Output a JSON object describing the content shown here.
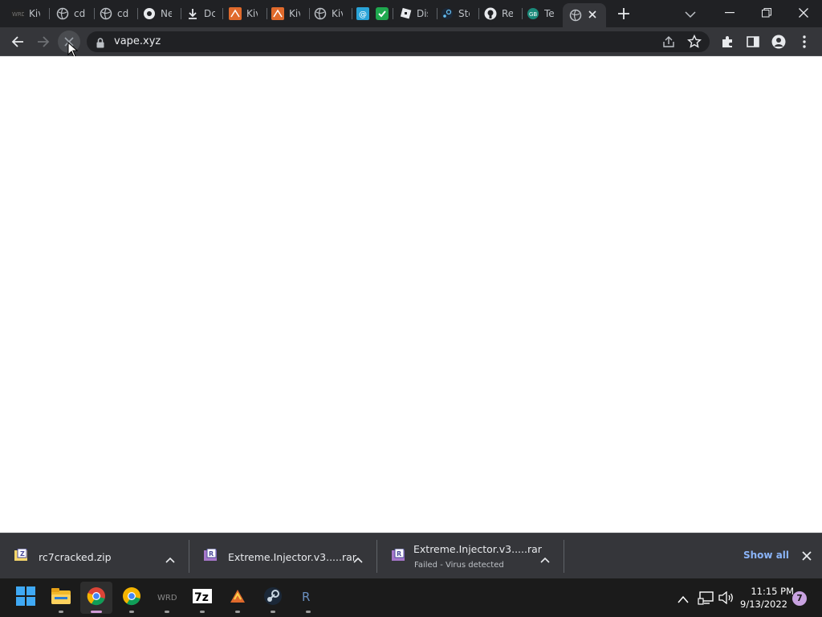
{
  "colors": {
    "tabstrip_bg": "#202124",
    "toolbar_bg": "#35363a",
    "omnibox_bg": "#202124",
    "page_bg": "#ffffff",
    "shelf_bg": "#35363a",
    "show_all": "#8ab4f8",
    "taskbar_bg": "#1b1b1b",
    "notification_badge": "#c8a2e0"
  },
  "tabs": [
    {
      "label": "Kiv",
      "icon": "wrd-icon"
    },
    {
      "label": "cd",
      "icon": "globe-icon"
    },
    {
      "label": "cd",
      "icon": "globe-icon"
    },
    {
      "label": "Ne",
      "icon": "chrome-icon"
    },
    {
      "label": "Dc",
      "icon": "download-icon"
    },
    {
      "label": "Kiv",
      "icon": "kiwi-icon"
    },
    {
      "label": "Kiv",
      "icon": "kiwi-icon"
    },
    {
      "label": "Kiv",
      "icon": "globe-icon"
    },
    {
      "label": "",
      "icon": "blue-app-icon"
    },
    {
      "label": "",
      "icon": "green-check-icon"
    },
    {
      "label": "Dis",
      "icon": "roblox-icon"
    },
    {
      "label": "Ste",
      "icon": "steam-icon"
    },
    {
      "label": "Re",
      "icon": "github-icon"
    },
    {
      "label": "Te",
      "icon": "teal-app-icon"
    }
  ],
  "active_tab": {
    "label": "",
    "icon": "globe-icon"
  },
  "address_bar": {
    "url": "vape.xyz"
  },
  "downloads": [
    {
      "name": "rc7cracked.zip",
      "status": ""
    },
    {
      "name": "Extreme.Injector.v3.....rar",
      "status": ""
    },
    {
      "name": "Extreme.Injector.v3.....rar",
      "status": "Failed - Virus detected"
    }
  ],
  "shelf": {
    "show_all_label": "Show all"
  },
  "taskbar": {
    "apps": [
      "start-icon",
      "file-explorer-icon",
      "chrome-icon",
      "chrome-alt-icon",
      "wrd-icon",
      "7zip-icon",
      "kiwi-icon",
      "steam-icon",
      "roblox-studio-icon"
    ],
    "time": "11:15 PM",
    "date": "9/13/2022",
    "notification_count": "7"
  }
}
